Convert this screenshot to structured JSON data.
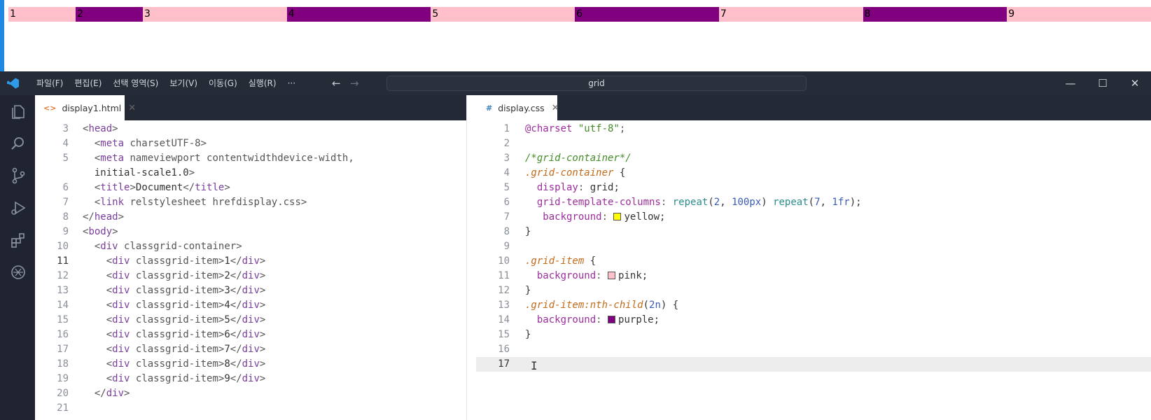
{
  "preview": {
    "grid_items": [
      "1",
      "2",
      "3",
      "4",
      "5",
      "6",
      "7",
      "8",
      "9"
    ],
    "colors": {
      "odd": "#ffc0cb",
      "even": "#800080"
    }
  },
  "titlebar": {
    "menus": [
      "파일(F)",
      "편집(E)",
      "선택 영역(S)",
      "보기(V)",
      "이동(G)",
      "실행(R)",
      "···"
    ],
    "search_text": "grid",
    "back_icon": "←",
    "forward_icon": "→",
    "minimize_icon": "—",
    "maximize_icon": "☐",
    "close_icon": "✕"
  },
  "left_editor": {
    "tab_label": "display1.html",
    "tab_icon": "<>",
    "lines": [
      {
        "n": "3",
        "t": "<head>"
      },
      {
        "n": "4",
        "t": "  <meta charset=\"UTF-8\">"
      },
      {
        "n": "5",
        "t": "  <meta name=\"viewport\" content=\"width=device-width,"
      },
      {
        "n": "",
        "t": "  initial-scale=1.0\">"
      },
      {
        "n": "6",
        "t": "  <title>Document</title>"
      },
      {
        "n": "7",
        "t": "  <link rel=\"stylesheet\" href=\"display.css\">"
      },
      {
        "n": "8",
        "t": "</head>"
      },
      {
        "n": "9",
        "t": "<body>"
      },
      {
        "n": "10",
        "t": "  <div class=\"grid-container\">"
      },
      {
        "n": "11",
        "t": "    <div class=\"grid-item\">1</div>"
      },
      {
        "n": "12",
        "t": "    <div class=\"grid-item\">2</div>"
      },
      {
        "n": "13",
        "t": "    <div class=\"grid-item\">3</div>"
      },
      {
        "n": "14",
        "t": "    <div class=\"grid-item\">4</div>"
      },
      {
        "n": "15",
        "t": "    <div class=\"grid-item\">5</div>"
      },
      {
        "n": "16",
        "t": "    <div class=\"grid-item\">6</div>"
      },
      {
        "n": "17",
        "t": "    <div class=\"grid-item\">7</div>"
      },
      {
        "n": "18",
        "t": "    <div class=\"grid-item\">8</div>"
      },
      {
        "n": "19",
        "t": "    <div class=\"grid-item\">9</div>"
      },
      {
        "n": "20",
        "t": "  </div>"
      },
      {
        "n": "21",
        "t": ""
      }
    ]
  },
  "right_editor": {
    "tab_label": "display.css",
    "tab_icon": "#",
    "lines": [
      {
        "n": "1",
        "t": "@charset \"utf-8\";"
      },
      {
        "n": "2",
        "t": ""
      },
      {
        "n": "3",
        "t": "/*grid-container*/"
      },
      {
        "n": "4",
        "t": ".grid-container {"
      },
      {
        "n": "5",
        "t": "  display: grid;"
      },
      {
        "n": "6",
        "t": "  grid-template-columns: repeat(2, 100px) repeat(7, 1fr);"
      },
      {
        "n": "7",
        "t": "   background:  yellow;"
      },
      {
        "n": "8",
        "t": "}"
      },
      {
        "n": "9",
        "t": ""
      },
      {
        "n": "10",
        "t": ".grid-item {"
      },
      {
        "n": "11",
        "t": "  background:  pink;"
      },
      {
        "n": "12",
        "t": "}"
      },
      {
        "n": "13",
        "t": ".grid-item:nth-child(2n) {"
      },
      {
        "n": "14",
        "t": "  background: purple;"
      },
      {
        "n": "15",
        "t": "}"
      },
      {
        "n": "16",
        "t": ""
      },
      {
        "n": "17",
        "t": ""
      }
    ],
    "swatches": {
      "yellow": "#ffff00",
      "pink": "#ffc0cb",
      "purple": "#800080"
    }
  }
}
